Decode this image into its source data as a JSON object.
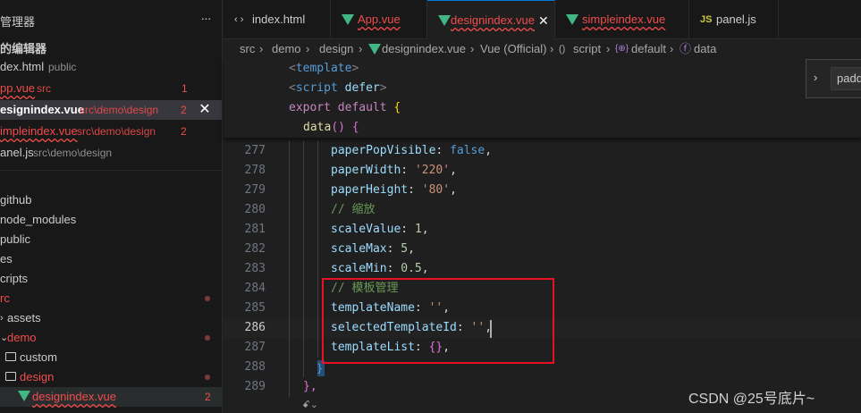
{
  "sidebar": {
    "title": "管理器",
    "section": "的编辑器",
    "open_editors": [
      {
        "name": "dex.html",
        "desc": "public",
        "count": ""
      },
      {
        "name": "pp.vue",
        "desc": "src",
        "count": "1"
      },
      {
        "name": "esignindex.vue",
        "desc": "src\\demo\\design",
        "count": "2"
      },
      {
        "name": "impleindex.vue",
        "desc": "src\\demo\\design",
        "count": "2"
      },
      {
        "name": "anel.js",
        "desc": "src\\demo\\design",
        "count": ""
      }
    ],
    "close_glyph": "✕",
    "tree": [
      {
        "label": "github"
      },
      {
        "label": "node_modules"
      },
      {
        "label": "public"
      },
      {
        "label": "es"
      },
      {
        "label": "cripts"
      },
      {
        "label": "rc"
      },
      {
        "label": "assets"
      },
      {
        "label": "demo"
      },
      {
        "label": "custom"
      },
      {
        "label": "design"
      },
      {
        "label": "designindex.vue",
        "count": "2"
      }
    ]
  },
  "tabs": [
    {
      "label": "index.html",
      "icon": "html-code-icon",
      "icon_text": "‹ ›"
    },
    {
      "label": "App.vue",
      "icon": "vue-icon"
    },
    {
      "label": "designindex.vue",
      "icon": "vue-icon",
      "close": "✕"
    },
    {
      "label": "simpleindex.vue",
      "icon": "vue-icon"
    },
    {
      "label": "panel.js",
      "icon": "js-icon",
      "icon_text": "JS"
    }
  ],
  "breadcrumb": [
    "src",
    "demo",
    "design",
    "designindex.vue",
    "Vue (Official)",
    "script",
    "default",
    "data"
  ],
  "breadcrumb_icons": {
    "script": "()",
    "default": "{⊕}",
    "data": "ⓕ"
  },
  "sticky": {
    "l1": {
      "open": "<",
      "tag": "template",
      "close": ">"
    },
    "l2": {
      "open": "<",
      "tag": "script",
      "attr": " defer",
      "close": ">"
    },
    "l3": {
      "kw1": "export",
      "kw2": " default ",
      "brace": "{"
    },
    "l4": {
      "fn": "data",
      "paren": "()",
      "brace": " {"
    }
  },
  "editor": {
    "lines": [
      {
        "num": "277",
        "key": "paperPopVisible",
        "val": "false",
        "val_type": "kw",
        "tail": ","
      },
      {
        "num": "278",
        "key": "paperWidth",
        "val": "'220'",
        "val_type": "str",
        "tail": ","
      },
      {
        "num": "279",
        "key": "paperHeight",
        "val": "'80'",
        "val_type": "str",
        "tail": ","
      },
      {
        "num": "280",
        "comment": "// 缩放"
      },
      {
        "num": "281",
        "key": "scaleValue",
        "val": "1",
        "val_type": "num",
        "tail": ","
      },
      {
        "num": "282",
        "key": "scaleMax",
        "val": "5",
        "val_type": "num",
        "tail": ","
      },
      {
        "num": "283",
        "key": "scaleMin",
        "val": "0.5",
        "val_type": "num",
        "tail": ","
      },
      {
        "num": "284",
        "comment": "// 模板管理"
      },
      {
        "num": "285",
        "key": "templateName",
        "val": "''",
        "val_type": "str",
        "tail": ","
      },
      {
        "num": "286",
        "key": "selectedTemplateId",
        "val": "''",
        "val_type": "str",
        "tail": ","
      },
      {
        "num": "287",
        "key": "templateList",
        "val": "{}",
        "val_type": "obj",
        "tail": ","
      },
      {
        "num": "288",
        "fold": "}"
      },
      {
        "num": "289",
        "close": "},"
      }
    ],
    "colon": ": "
  },
  "right_widget": {
    "chevron": "›",
    "input_value": "padd"
  },
  "watermark": "CSDN @25号底片~",
  "bottom_glyph": "ꗃ⌄",
  "colors": {
    "accent": "#0078d4",
    "error": "#f14c4c",
    "highlight_box": "#e81123",
    "vue": "#41b883"
  }
}
